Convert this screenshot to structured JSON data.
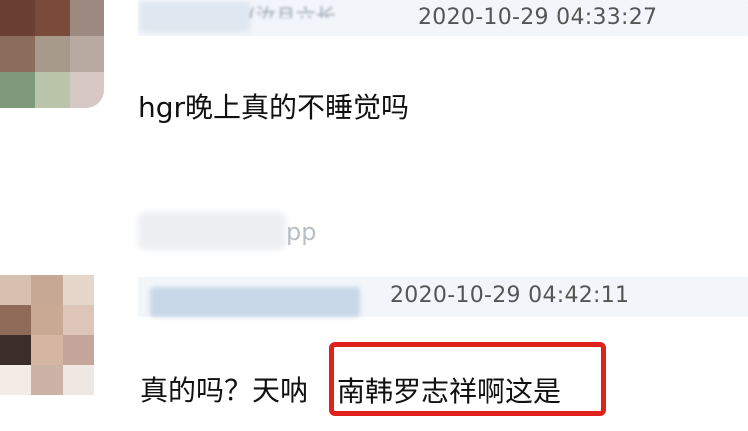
{
  "comments": [
    {
      "nickname_partial": "(汝且六长",
      "timestamp": "2020-10-29 04:33:27",
      "text": "hgr晚上真的不睡觉吗",
      "source_suffix": "pp"
    },
    {
      "timestamp": "2020-10-29 04:42:11",
      "text": "真的吗？天呐",
      "highlighted_text": "南韩罗志祥啊这是"
    }
  ],
  "colors": {
    "highlight_border": "#e0201b",
    "header_background": "#f2f5fa"
  }
}
